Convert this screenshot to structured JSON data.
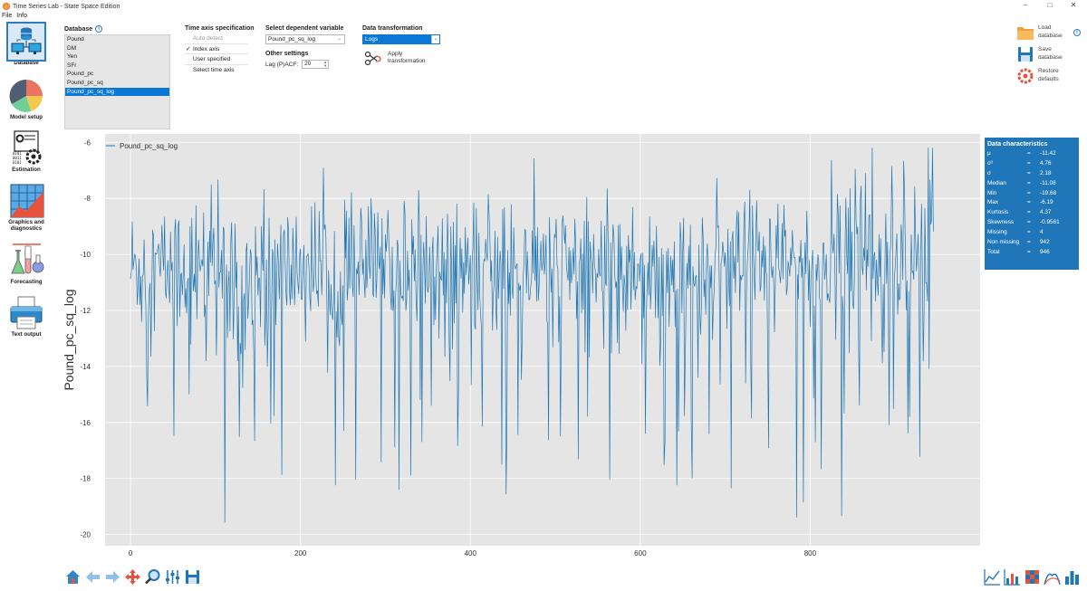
{
  "window": {
    "title": "Time Series Lab - State Space Edition",
    "minimize": "–",
    "maximize": "□",
    "close": "✕"
  },
  "menu": [
    "File",
    "Info"
  ],
  "sidebar": [
    {
      "label": "Database",
      "icon": "database-icon"
    },
    {
      "label": "Model setup",
      "icon": "pie-chart-icon"
    },
    {
      "label": "Estimation",
      "icon": "gears-icon"
    },
    {
      "label": "Graphics and diagnostics",
      "icon": "chart-icon"
    },
    {
      "label": "Forecasting",
      "icon": "flasks-icon"
    },
    {
      "label": "Text output",
      "icon": "printer-icon"
    }
  ],
  "database": {
    "label": "Database",
    "items": [
      "Pound",
      "DM",
      "Yen",
      "SFr",
      "Pound_pc",
      "Pound_pc_sq",
      "Pound_pc_sq_log"
    ],
    "selected": "Pound_pc_sq_log"
  },
  "time_axis": {
    "label": "Time axis specification",
    "options": [
      "Auto detect",
      "Index axis",
      "User specified",
      "Select time axis"
    ],
    "checked": "Index axis"
  },
  "dependent": {
    "label": "Select dependent variable",
    "value": "Pound_pc_sq_log"
  },
  "other_settings": {
    "label": "Other settings",
    "lag_label": "Lag (P)ACF:",
    "lag_value": "20"
  },
  "transform": {
    "label": "Data transformation",
    "value": "Logs",
    "apply_label_1": "Apply",
    "apply_label_2": "transformation"
  },
  "right_actions": [
    {
      "l1": "Load",
      "l2": "database",
      "icon": "folder-icon"
    },
    {
      "l1": "Save",
      "l2": "database",
      "icon": "floppy-icon"
    },
    {
      "l1": "Restore",
      "l2": "defaults",
      "icon": "restore-icon"
    }
  ],
  "stats": {
    "title": "Data characteristics",
    "rows": [
      {
        "k": "μ",
        "v": "-11.42"
      },
      {
        "k": "σ²",
        "v": "4.76"
      },
      {
        "k": "σ",
        "v": "2.18"
      },
      {
        "k": "Median",
        "v": "-11.08"
      },
      {
        "k": "Min",
        "v": "-19.68"
      },
      {
        "k": "Max",
        "v": "-6.19"
      },
      {
        "k": "Kurtosis",
        "v": "4.37"
      },
      {
        "k": "Skewness",
        "v": "-0.9561"
      },
      {
        "k": "Missing",
        "v": "4"
      },
      {
        "k": "Non missing",
        "v": "942"
      },
      {
        "k": "Total",
        "v": "946"
      }
    ]
  },
  "colors": {
    "accent": "#1f76b9",
    "selection": "#0a78d4",
    "line": "#1f77b4",
    "plot_bg": "#e5e5e5"
  },
  "chart_data": {
    "type": "line",
    "ylabel": "Pound_pc_sq_log",
    "xlabel": "",
    "xlim": [
      -30,
      1000
    ],
    "ylim": [
      -20.4,
      -5.7
    ],
    "xticks": [
      0,
      200,
      400,
      600,
      800
    ],
    "yticks": [
      -6,
      -8,
      -10,
      -12,
      -14,
      -16,
      -18,
      -20
    ],
    "grid": true,
    "legend_position": "top-left",
    "series": [
      {
        "name": "Pound_pc_sq_log",
        "x_start": 0,
        "x_end": 945,
        "n": 946,
        "mean": -11.42,
        "sd": 2.18,
        "min": -19.68,
        "max": -6.19
      }
    ]
  },
  "toolbar_icons": [
    "home-icon",
    "back-arrow-icon",
    "forward-arrow-icon",
    "pan-icon",
    "zoom-icon",
    "configure-icon",
    "save-figure-icon"
  ],
  "plot_type_icons": [
    "line-plot-icon",
    "bar-plot-icon",
    "heatmap-icon",
    "density-icon",
    "histogram-icon"
  ]
}
